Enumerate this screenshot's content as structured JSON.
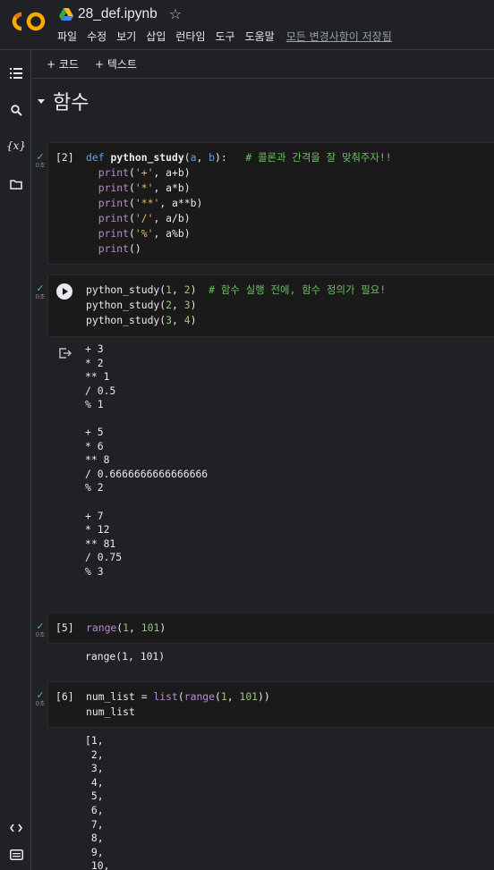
{
  "header": {
    "title": "28_def.ipynb",
    "menu": [
      "파일",
      "수정",
      "보기",
      "삽입",
      "런타임",
      "도구",
      "도움말"
    ],
    "save_status": "모든 변경사항이 저장됨"
  },
  "toolbar": {
    "add_code": "+ 코드",
    "add_text": "+ 텍스트"
  },
  "section": {
    "title": "함수"
  },
  "cells": [
    {
      "count": "[2]",
      "time": "0초",
      "lines": [
        [
          {
            "t": "def",
            "c": "kw"
          },
          {
            "t": " "
          },
          {
            "t": "python_study",
            "c": "fn"
          },
          {
            "t": "("
          },
          {
            "t": "a",
            "c": "kw"
          },
          {
            "t": ", "
          },
          {
            "t": "b",
            "c": "kw"
          },
          {
            "t": "):   "
          },
          {
            "t": "# 콜론과 간격을 잘 맞춰주자!!",
            "c": "cm"
          }
        ],
        [
          {
            "t": "  "
          },
          {
            "t": "print",
            "c": "bi"
          },
          {
            "t": "("
          },
          {
            "t": "'+'",
            "c": "str"
          },
          {
            "t": ", a+b)"
          }
        ],
        [
          {
            "t": "  "
          },
          {
            "t": "print",
            "c": "bi"
          },
          {
            "t": "("
          },
          {
            "t": "'*'",
            "c": "str"
          },
          {
            "t": ", a*b)"
          }
        ],
        [
          {
            "t": "  "
          },
          {
            "t": "print",
            "c": "bi"
          },
          {
            "t": "("
          },
          {
            "t": "'**'",
            "c": "str"
          },
          {
            "t": ", a**b)"
          }
        ],
        [
          {
            "t": "  "
          },
          {
            "t": "print",
            "c": "bi"
          },
          {
            "t": "("
          },
          {
            "t": "'/'",
            "c": "str"
          },
          {
            "t": ", a/b)"
          }
        ],
        [
          {
            "t": "  "
          },
          {
            "t": "print",
            "c": "bi"
          },
          {
            "t": "("
          },
          {
            "t": "'%'",
            "c": "str"
          },
          {
            "t": ", a%b)"
          }
        ],
        [
          {
            "t": "  "
          },
          {
            "t": "print",
            "c": "bi"
          },
          {
            "t": "()"
          }
        ]
      ]
    },
    {
      "count": "",
      "time": "0초",
      "lines": [
        [
          {
            "t": "python_study("
          },
          {
            "t": "1",
            "c": "num"
          },
          {
            "t": ", "
          },
          {
            "t": "2",
            "c": "num"
          },
          {
            "t": ")  "
          },
          {
            "t": "# 함수 실행 전에, 함수 정의가 필요!",
            "c": "cm"
          }
        ],
        [
          {
            "t": "python_study("
          },
          {
            "t": "2",
            "c": "num"
          },
          {
            "t": ", "
          },
          {
            "t": "3",
            "c": "num"
          },
          {
            "t": ")"
          }
        ],
        [
          {
            "t": "python_study("
          },
          {
            "t": "3",
            "c": "num"
          },
          {
            "t": ", "
          },
          {
            "t": "4",
            "c": "num"
          },
          {
            "t": ")"
          }
        ]
      ],
      "output": "+ 3\n* 2\n** 1\n/ 0.5\n% 1\n\n+ 5\n* 6\n** 8\n/ 0.6666666666666666\n% 2\n\n+ 7\n* 12\n** 81\n/ 0.75\n% 3"
    },
    {
      "count": "[5]",
      "time": "0초",
      "lines": [
        [
          {
            "t": "range",
            "c": "bi"
          },
          {
            "t": "("
          },
          {
            "t": "1",
            "c": "num"
          },
          {
            "t": ", "
          },
          {
            "t": "101",
            "c": "num"
          },
          {
            "t": ")"
          }
        ]
      ],
      "output": "range(1, 101)"
    },
    {
      "count": "[6]",
      "time": "0초",
      "lines": [
        [
          {
            "t": "num_list = "
          },
          {
            "t": "list",
            "c": "bi"
          },
          {
            "t": "("
          },
          {
            "t": "range",
            "c": "bi"
          },
          {
            "t": "("
          },
          {
            "t": "1",
            "c": "num"
          },
          {
            "t": ", "
          },
          {
            "t": "101",
            "c": "num"
          },
          {
            "t": "))"
          }
        ],
        [
          {
            "t": "num_list"
          }
        ]
      ],
      "output": "[1,\n 2,\n 3,\n 4,\n 5,\n 6,\n 7,\n 8,\n 9,\n 10,"
    }
  ],
  "icons": {
    "rail": [
      "table-of-contents-icon",
      "search-icon",
      "variables-icon",
      "files-icon",
      "code-snippets-icon",
      "terminal-icon"
    ],
    "colors": {
      "check": "#5bb974",
      "keyword": "#6a9fe0",
      "builtin": "#b78bd6",
      "string": "#e8b86d",
      "number": "#98c379",
      "comment": "#67c25e"
    }
  }
}
